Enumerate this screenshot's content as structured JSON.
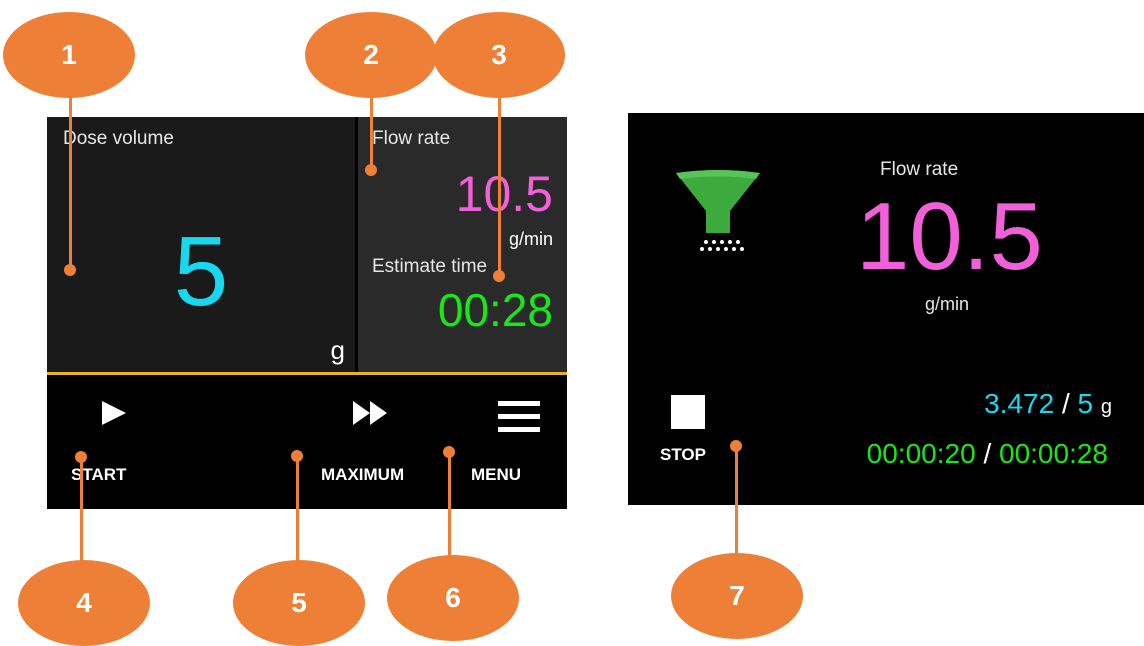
{
  "left_screen": {
    "dose": {
      "label": "Dose volume",
      "value": "5",
      "unit": "g"
    },
    "flow": {
      "label": "Flow rate",
      "value": "10.5",
      "unit": "g/min"
    },
    "estimate": {
      "label": "Estimate time",
      "value": "00:28"
    },
    "buttons": {
      "start": "START",
      "maximum": "MAXIMUM",
      "menu": "MENU"
    }
  },
  "right_screen": {
    "flow": {
      "label": "Flow rate",
      "value": "10.5",
      "unit": "g/min"
    },
    "progress": {
      "current": "3.472",
      "separator": "/",
      "total": "5",
      "unit": "g"
    },
    "time": {
      "elapsed": "00:00:20",
      "separator": "/",
      "total": "00:00:28"
    },
    "stop_label": "STOP"
  },
  "callouts": [
    "1",
    "2",
    "3",
    "4",
    "5",
    "6",
    "7"
  ],
  "colors": {
    "accent_cyan": "#18d8f0",
    "accent_magenta": "#f060d8",
    "accent_green": "#18e818",
    "divider_yellow": "#e8b320",
    "callout_orange": "#ee7f36",
    "funnel_green": "#3daa3d"
  },
  "icons": [
    "play-icon",
    "fast-forward-icon",
    "menu-icon",
    "funnel-icon",
    "stop-icon"
  ]
}
